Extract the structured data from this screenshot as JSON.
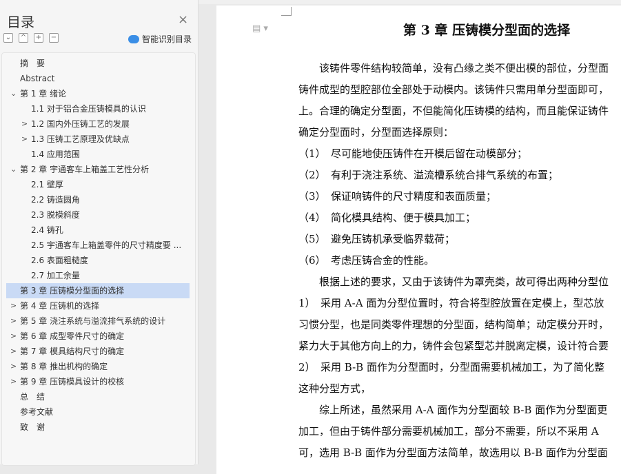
{
  "sidebar": {
    "title": "目录",
    "close_icon": "×",
    "tools": [
      "⌄",
      "^",
      "+",
      "−"
    ],
    "smart_label": "智能识别目录"
  },
  "toc": [
    {
      "text": "摘　要",
      "level": 0,
      "arrow": ""
    },
    {
      "text": "Abstract",
      "level": 0,
      "arrow": ""
    },
    {
      "text": "第 1 章  绪论",
      "level": 0,
      "arrow": "⌄"
    },
    {
      "text": "1.1  对于铝合金压铸模具的认识",
      "level": 1,
      "arrow": ""
    },
    {
      "text": "1.2  国内外压铸工艺的发展",
      "level": 1,
      "arrow": ">"
    },
    {
      "text": "1.3  压铸工艺原理及优缺点",
      "level": 1,
      "arrow": ">"
    },
    {
      "text": "1.4  应用范围",
      "level": 1,
      "arrow": ""
    },
    {
      "text": "第 2 章  宇通客车上箱盖工艺性分析",
      "level": 0,
      "arrow": "⌄"
    },
    {
      "text": "2.1 壁厚",
      "level": 1,
      "arrow": ""
    },
    {
      "text": "2.2 铸造圆角",
      "level": 1,
      "arrow": ""
    },
    {
      "text": "2.3 脱模斜度",
      "level": 1,
      "arrow": ""
    },
    {
      "text": "2.4 铸孔",
      "level": 1,
      "arrow": ""
    },
    {
      "text": "2.5 宇通客车上箱盖零件的尺寸精度要 ...",
      "level": 1,
      "arrow": ""
    },
    {
      "text": "2.6 表面粗糙度",
      "level": 1,
      "arrow": ""
    },
    {
      "text": "2.7 加工余量",
      "level": 1,
      "arrow": ""
    },
    {
      "text": "第 3 章  压铸模分型面的选择",
      "level": 0,
      "arrow": "",
      "selected": true
    },
    {
      "text": "第 4 章  压铸机的选择",
      "level": 0,
      "arrow": ">"
    },
    {
      "text": "第 5 章  浇注系统与溢流排气系统的设计",
      "level": 0,
      "arrow": ">"
    },
    {
      "text": "第 6 章  成型零件尺寸的确定",
      "level": 0,
      "arrow": ">"
    },
    {
      "text": "第 7 章  模具结构尺寸的确定",
      "level": 0,
      "arrow": ">"
    },
    {
      "text": "第 8 章  推出机构的确定",
      "level": 0,
      "arrow": ">"
    },
    {
      "text": "第 9 章  压铸模具设计的校核",
      "level": 0,
      "arrow": ">"
    },
    {
      "text": "总　结",
      "level": 0,
      "arrow": ""
    },
    {
      "text": "参考文献",
      "level": 0,
      "arrow": ""
    },
    {
      "text": "致　谢",
      "level": 0,
      "arrow": ""
    }
  ],
  "document": {
    "title": "第 3 章  压铸模分型面的选择",
    "paragraphs": [
      "　　该铸件零件结构较简单，没有凸缘之类不便出模的部位，分型面",
      "铸件成型的型腔部位全部处于动模内。该铸件只需用单分型面即可，",
      "上。合理的确定分型面，不但能简化压铸模的结构，而且能保证铸件",
      "确定分型面时，分型面选择原则：",
      "（1）　尽可能地使压铸件在开模后留在动模部分；",
      "（2）　有利于浇注系统、溢流槽系统合排气系统的布置；",
      "（3）　保证响铸件的尺寸精度和表面质量；",
      "（4）　简化模具结构、便于模具加工；",
      "（5）　避免压铸机承受临界载荷；",
      "（6）　考虑压铸合金的性能。",
      "　　根据上述的要求，又由于该铸件为罩壳类，故可得出两种分型位",
      "1）　采用 A-A 面为分型位置时，符合将型腔放置在定模上，型芯放",
      "习惯分型，也是同类零件理想的分型面，结构简单；动定模分开时，",
      "紧力大于其他方向上的力，铸件会包紧型芯并脱离定模，设计符合要",
      "2）　采用 B-B 面作为分型面时，分型面需要机械加工，为了简化整",
      "这种分型方式，",
      "　　综上所述，虽然采用 A-A 面作为分型面较 B-B 面作为分型面更",
      "加工，但由于铸件部分需要机械加工，部分不需要，所以不采用 A",
      "可，选用 B-B 面作为分型面方法简单，故选用以 B-B 面作为分型面"
    ]
  }
}
